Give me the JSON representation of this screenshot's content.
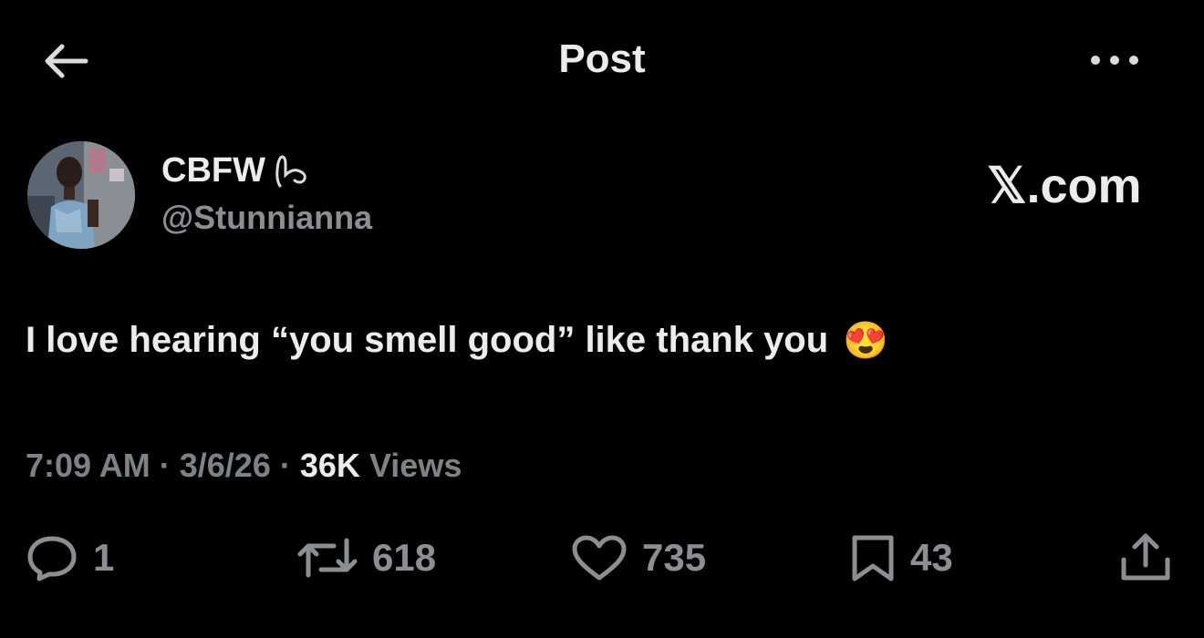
{
  "header": {
    "title": "Post",
    "back_icon": "arrow-left-icon",
    "more_icon": "ellipsis-icon"
  },
  "author": {
    "display_name": "CBFW",
    "badge_icon": "hand-gesture-icon",
    "handle": "@Stunnianna"
  },
  "brand": {
    "mark": "𝕏",
    "domain": ".com"
  },
  "post": {
    "text": "I love hearing “you smell good” like thank you",
    "emoji": "😍"
  },
  "meta": {
    "time": "7:09 AM",
    "separator": "·",
    "date": "3/6/26",
    "views_count": "36K",
    "views_label": "Views"
  },
  "actions": {
    "replies": "1",
    "reposts": "618",
    "likes": "735",
    "bookmarks": "43"
  },
  "colors": {
    "background": "#000000",
    "primary_text": "#ececec",
    "secondary_text": "#8b8f94"
  }
}
